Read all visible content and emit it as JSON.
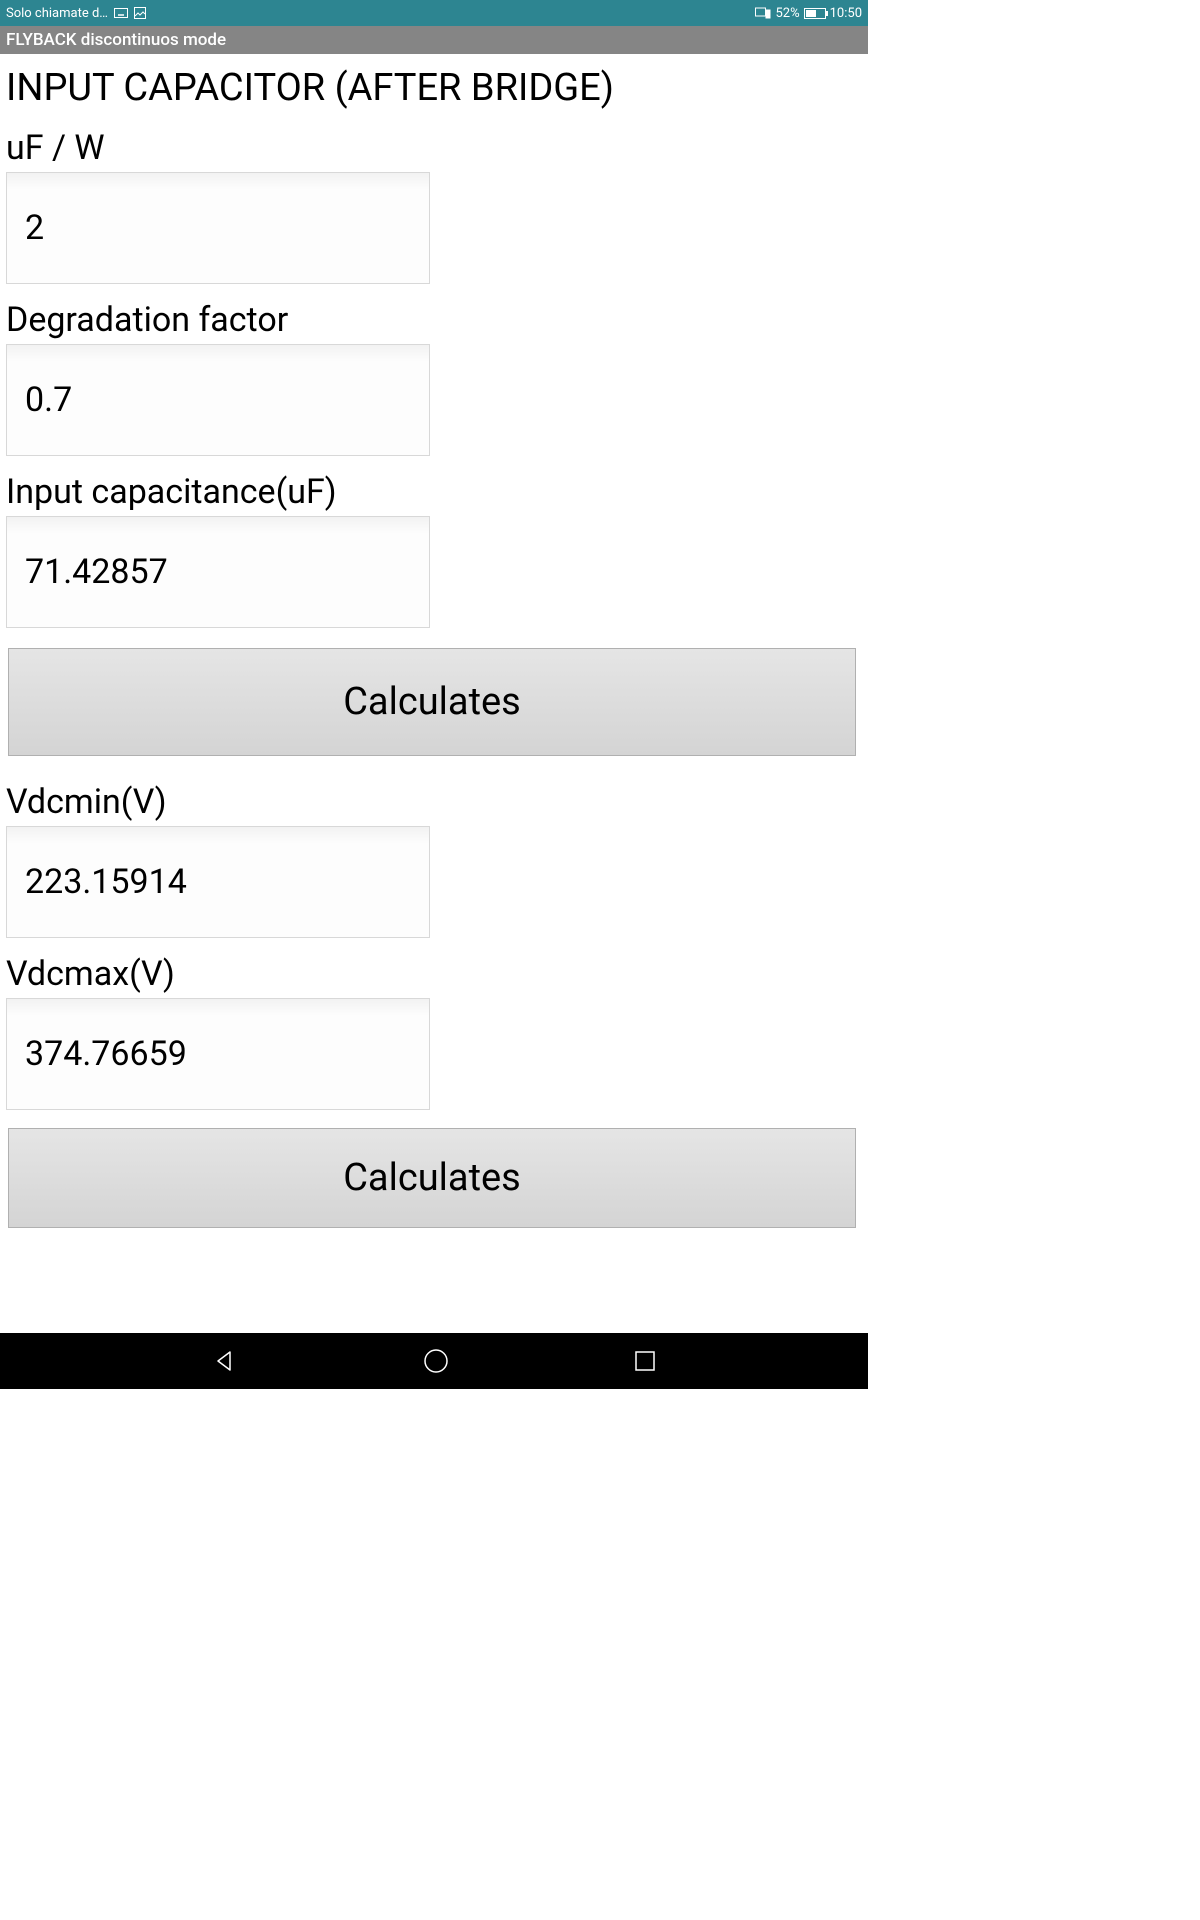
{
  "statusBar": {
    "leftText": "Solo chiamate d…",
    "batteryPercent": "52%",
    "time": "10:50"
  },
  "header": {
    "title": "FLYBACK discontinuos mode"
  },
  "page": {
    "title": "INPUT CAPACITOR (AFTER BRIDGE)"
  },
  "fields": {
    "ufPerW": {
      "label": "uF / W",
      "value": "2"
    },
    "degradation": {
      "label": "Degradation factor",
      "value": "0.7"
    },
    "inputCap": {
      "label": "Input capacitance(uF)",
      "value": "71.42857"
    },
    "vdcmin": {
      "label": "Vdcmin(V)",
      "value": "223.15914"
    },
    "vdcmax": {
      "label": "Vdcmax(V)",
      "value": "374.76659"
    }
  },
  "buttons": {
    "calculate1": "Calculates",
    "calculate2": "Calculates"
  }
}
